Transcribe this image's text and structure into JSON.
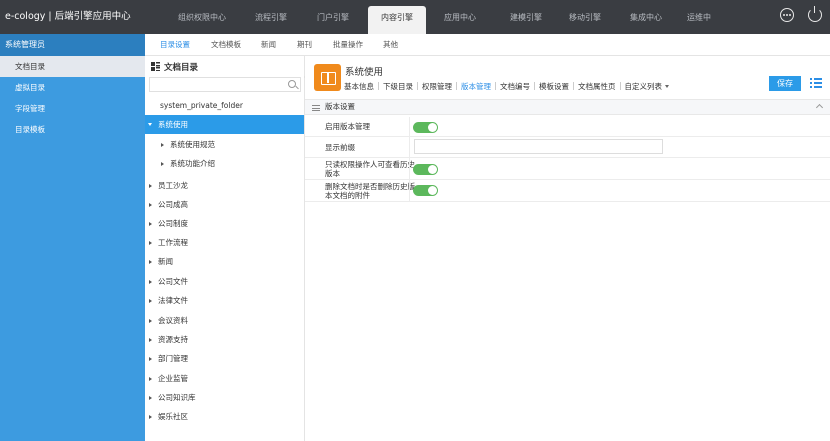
{
  "app": {
    "brand": "e-cology | 后端引擎应用中心"
  },
  "top_nav": {
    "tabs": [
      {
        "label": "组织权限中心"
      },
      {
        "label": "流程引擎"
      },
      {
        "label": "门户引擎"
      },
      {
        "label": "内容引擎",
        "active": true
      },
      {
        "label": "应用中心"
      },
      {
        "label": "建模引擎"
      },
      {
        "label": "移动引擎"
      },
      {
        "label": "集成中心"
      },
      {
        "label": "运维中"
      }
    ]
  },
  "sidebar": {
    "header": "系统管理员",
    "items": [
      {
        "label": "文档目录",
        "active": true
      },
      {
        "label": "虚拟目录"
      },
      {
        "label": "字段管理"
      },
      {
        "label": "目录模板"
      }
    ]
  },
  "sub_nav": {
    "tabs": [
      {
        "label": "目录设置",
        "active": true
      },
      {
        "label": "文档模板"
      },
      {
        "label": "新闻"
      },
      {
        "label": "期刊"
      },
      {
        "label": "批量操作"
      },
      {
        "label": "其他"
      }
    ]
  },
  "tree": {
    "title": "文档目录",
    "search_placeholder": "",
    "rows": [
      {
        "label": "system_private_folder",
        "level": 0,
        "caret": "none"
      },
      {
        "label": "系统使用",
        "level": 0,
        "caret": "down",
        "selected": true
      },
      {
        "label": "系统使用规范",
        "level": 1,
        "caret": "right"
      },
      {
        "label": "系统功能介绍",
        "level": 1,
        "caret": "right"
      },
      {
        "label": "员工沙龙",
        "level": 0,
        "caret": "right"
      },
      {
        "label": "公司成高",
        "level": 0,
        "caret": "right"
      },
      {
        "label": "公司制度",
        "level": 0,
        "caret": "right"
      },
      {
        "label": "工作流程",
        "level": 0,
        "caret": "right"
      },
      {
        "label": "新闻",
        "level": 0,
        "caret": "right"
      },
      {
        "label": "公司文件",
        "level": 0,
        "caret": "right"
      },
      {
        "label": "法律文件",
        "level": 0,
        "caret": "right"
      },
      {
        "label": "会议资料",
        "level": 0,
        "caret": "right"
      },
      {
        "label": "资源支持",
        "level": 0,
        "caret": "right"
      },
      {
        "label": "部门管理",
        "level": 0,
        "caret": "right"
      },
      {
        "label": "企业监管",
        "level": 0,
        "caret": "right"
      },
      {
        "label": "公司知识库",
        "level": 0,
        "caret": "right"
      },
      {
        "label": "娱乐社区",
        "level": 0,
        "caret": "right"
      }
    ]
  },
  "content": {
    "title": "系统使用",
    "tabs": [
      {
        "label": "基本信息"
      },
      {
        "label": "下级目录"
      },
      {
        "label": "权限管理"
      },
      {
        "label": "版本管理",
        "active": true
      },
      {
        "label": "文档编号"
      },
      {
        "label": "模板设置"
      },
      {
        "label": "文档属性页"
      },
      {
        "label": "自定义列表",
        "dropdown": true
      }
    ],
    "save_label": "保存",
    "section_title": "版本设置",
    "fields": [
      {
        "label": "启用版本管理",
        "type": "toggle",
        "value": true
      },
      {
        "label": "显示前缀",
        "type": "text",
        "value": ""
      },
      {
        "label": "只读权限操作人可查看历史版本",
        "type": "toggle",
        "value": true
      },
      {
        "label": "删除文档时是否删除历史版本文档的附件",
        "type": "toggle",
        "value": true
      }
    ]
  },
  "colors": {
    "topbar": "#3a3d42",
    "sidebar": "#3d9be0",
    "accent": "#2b9be8",
    "toggle_on": "#5cb85c",
    "title_icon": "#f08a1c"
  }
}
